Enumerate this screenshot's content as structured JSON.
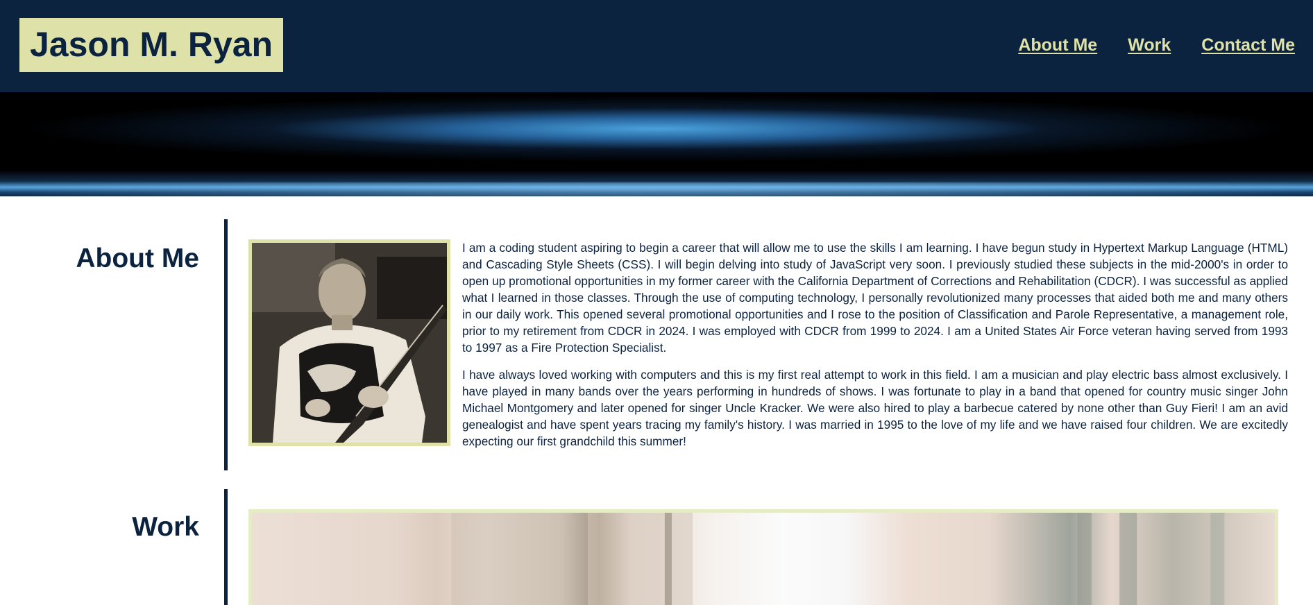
{
  "header": {
    "brand_name": "Jason M. Ryan",
    "nav": [
      {
        "label": "About Me"
      },
      {
        "label": "Work"
      },
      {
        "label": "Contact Me"
      }
    ]
  },
  "about": {
    "title": "About Me",
    "paragraphs": [
      "I am a coding student aspiring to begin a career that will allow me to use the skills I am learning. I have begun study in Hypertext Markup Language (HTML) and Cascading Style Sheets (CSS). I will begin delving into study of JavaScript very soon. I previously studied these subjects in the mid-2000's in order to open up promotional opportunities in my former career with the California Department of Corrections and Rehabilitation (CDCR). I was successful as applied what I learned in those classes. Through the use of computing technology, I personally revolutionized many processes that aided both me and many others in our daily work. This opened several promotional opportunities and I rose to the position of Classification and Parole Representative, a management role, prior to my retirement from CDCR in 2024. I was employed with CDCR from 1999 to 2024. I am a United States Air Force veteran having served from 1993 to 1997 as a Fire Protection Specialist.",
      "I have always loved working with computers and this is my first real attempt to work in this field. I am a musician and play electric bass almost exclusively. I have played in many bands over the years performing in hundreds of shows. I was fortunate to play in a band that opened for country music singer John Michael Montgomery and later opened for singer Uncle Kracker. We were also hired to play a barbecue catered by none other than Guy Fieri! I am an avid genealogist and have spent years tracing my family's history. I was married in 1995 to the love of my life and we have raised four children. We are excitedly expecting our first grandchild this summer!"
    ]
  },
  "work": {
    "title": "Work"
  },
  "colors": {
    "navy": "#0c2340",
    "accent": "#dfe2a8",
    "hero_blue": "#4eaae8"
  }
}
